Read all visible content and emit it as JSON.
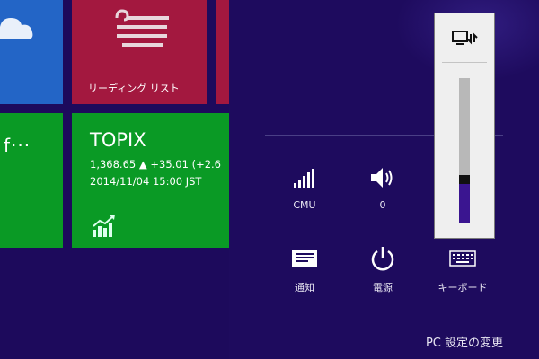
{
  "start_screen": {
    "reading_list": {
      "label": "リーディング リスト"
    },
    "finance_partial": {
      "text": "f···"
    },
    "topix": {
      "title": "TOPIX",
      "quote": "1,368.65 ▲ +35.01 (+2.6",
      "datetime": "2014/11/04 15:00 JST"
    },
    "icons": [
      "cloud-icon",
      "reading-list-icon",
      "chart-icon"
    ],
    "colors": {
      "weather": "#2365c6",
      "reading": "#a3183f",
      "finance": "#0a9a25",
      "background": "#1d0a5c"
    }
  },
  "settings_charm": {
    "quick_settings": [
      {
        "id": "network",
        "label": "CMU",
        "icon": "signal-bars-icon"
      },
      {
        "id": "volume",
        "label": "0",
        "icon": "speaker-icon"
      },
      {
        "id": "notifications",
        "label": "通知",
        "icon": "notification-icon"
      },
      {
        "id": "power",
        "label": "電源",
        "icon": "power-icon"
      },
      {
        "id": "keyboard",
        "label": "キーボード",
        "icon": "keyboard-icon"
      }
    ],
    "change_pc_settings": "PC 設定の変更",
    "colors": {
      "background": "#1e0b5e",
      "accent": "#3a1590"
    }
  },
  "volume_flyout": {
    "icon": "speaker-switch-icon",
    "level": 0.27
  }
}
